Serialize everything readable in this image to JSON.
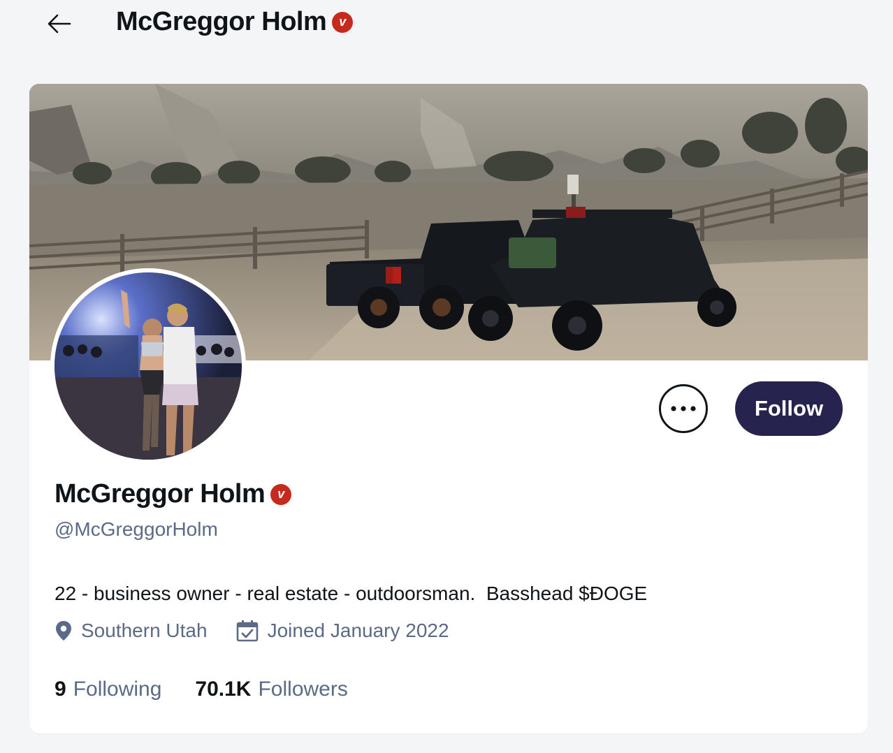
{
  "header": {
    "back_label": "Back",
    "title": "McGreggor Holm",
    "verified_mark": "v"
  },
  "icons": {
    "back": "arrow-left-icon",
    "verified": "verified-badge-icon",
    "more": "more-horizontal-icon",
    "location": "location-pin-icon",
    "calendar": "calendar-icon"
  },
  "profile": {
    "display_name": "McGreggor Holm",
    "verified_mark": "v",
    "handle": "@McGreggorHolm",
    "bio": "22 - business owner - real estate - outdoorsman.  Basshead $ĐOGE",
    "location": "Southern Utah",
    "joined": "Joined January 2022",
    "follow_label": "Follow",
    "stats": {
      "following_count": "9",
      "following_label": "Following",
      "followers_count": "70.1K",
      "followers_label": "Followers"
    }
  },
  "colors": {
    "background": "#f4f5f7",
    "card": "#ffffff",
    "follow_button": "#26234f",
    "verified_badge": "#c62a1c",
    "secondary_text": "#5b6a86"
  }
}
